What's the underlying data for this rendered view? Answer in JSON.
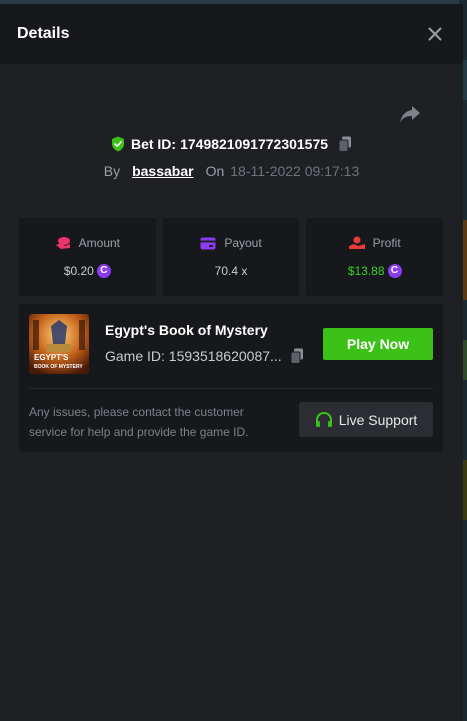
{
  "modal": {
    "title": "Details"
  },
  "bet": {
    "id_label": "Bet ID:",
    "id_value": "1749821091772301575",
    "by_label": "By",
    "username": "bassabar",
    "on_label": "On",
    "datetime": "18-11-2022 09:17:13"
  },
  "stats": {
    "amount": {
      "label": "Amount",
      "value": "$0.20",
      "color": "#e8336b"
    },
    "payout": {
      "label": "Payout",
      "value": "70.4 x",
      "color": "#8b3cf0"
    },
    "profit": {
      "label": "Profit",
      "value": "$13.88",
      "color": "#e83a3a"
    }
  },
  "coin": {
    "symbol": "C",
    "color": "#8b3cf0"
  },
  "game": {
    "name": "Egypt's Book of Mystery",
    "id_text": "Game ID: 1593518620087...",
    "thumb_title": "EGYPT'S",
    "thumb_sub": "BOOK OF MYSTERY",
    "play_label": "Play Now"
  },
  "support": {
    "note": "Any issues, please contact the customer service for help and provide the game ID.",
    "button_label": "Live Support"
  },
  "colors": {
    "accent_green": "#3bc117",
    "profit_green": "#3bd12a"
  },
  "icons": [
    "close-icon",
    "share-icon",
    "shield-check-icon",
    "copy-icon",
    "amount-icon",
    "payout-icon",
    "profit-icon",
    "coin-icon",
    "headset-icon"
  ]
}
